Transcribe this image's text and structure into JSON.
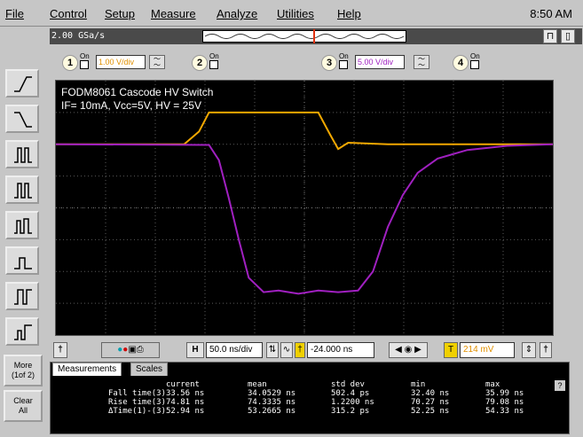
{
  "menu": {
    "items": [
      "File",
      "Control",
      "Setup",
      "Measure",
      "Analyze",
      "Utilities",
      "Help"
    ],
    "clock": "8:50 AM"
  },
  "top": {
    "sample_rate": "2.00 GSa/s"
  },
  "channels": [
    {
      "num": "1",
      "on": "On",
      "scale": "1.00 V/div",
      "color": "#f2a800"
    },
    {
      "num": "2",
      "on": "On",
      "scale": "",
      "color": "#00a000"
    },
    {
      "num": "3",
      "on": "On",
      "scale": "5.00 V/div",
      "color": "#a020c0"
    },
    {
      "num": "4",
      "on": "On",
      "scale": "",
      "color": "#e04040"
    }
  ],
  "plot": {
    "title_line1": "FODM8061 Cascode HV Switch",
    "title_line2": "IF= 10mA, Vcc=5V, HV = 25V"
  },
  "chart_data": {
    "type": "line",
    "title": "FODM8061 Cascode HV Switch",
    "subtitle": "IF= 10mA, Vcc=5V, HV = 25V",
    "xlabel": "",
    "ylabel": "",
    "x_range_ns": [
      -274,
      226
    ],
    "y_range_div": [
      -4,
      4
    ],
    "grid": true,
    "series": [
      {
        "name": "1",
        "color": "#f2a800",
        "points_x_ns": [
          -274,
          -145,
          -130,
          -120,
          -20,
          -10,
          2,
          10,
          20,
          60,
          226
        ],
        "points_y_div": [
          2.0,
          2.0,
          2.4,
          3.0,
          3.0,
          3.0,
          2.3,
          1.85,
          2.05,
          2.0,
          2.0
        ]
      },
      {
        "name": "3",
        "color": "#a020c0",
        "points_x_ns": [
          -274,
          -120,
          -110,
          -100,
          -90,
          -80,
          -65,
          -50,
          -30,
          -10,
          10,
          30,
          45,
          60,
          75,
          90,
          110,
          140,
          180,
          226
        ],
        "points_y_div": [
          2.0,
          1.98,
          1.5,
          0.3,
          -1.0,
          -2.2,
          -2.65,
          -2.6,
          -2.7,
          -2.6,
          -2.65,
          -2.6,
          -2.0,
          -0.6,
          0.4,
          1.1,
          1.55,
          1.82,
          1.95,
          2.0
        ]
      }
    ]
  },
  "horizontal": {
    "timebase": "50.0 ns/div",
    "delay": "-24.000 ns",
    "trigger_level": "214 mV"
  },
  "measurements": {
    "tabs": [
      "Measurements",
      "Scales"
    ],
    "headers": [
      "current",
      "mean",
      "std dev",
      "min",
      "max"
    ],
    "rows": [
      {
        "label": "Fall time(3)",
        "current": "33.56 ns",
        "mean": "34.0529 ns",
        "std_dev": "502.4 ps",
        "min": "32.40 ns",
        "max": "35.99 ns"
      },
      {
        "label": "Rise time(3)",
        "current": "74.81 ns",
        "mean": "74.3335 ns",
        "std_dev": "1.2200 ns",
        "min": "70.27 ns",
        "max": "79.08 ns"
      },
      {
        "label": "ΔTime(1)-(3)",
        "current": "52.94 ns",
        "mean": "53.2665 ns",
        "std_dev": "315.2 ps",
        "min": "52.25 ns",
        "max": "54.33 ns"
      }
    ]
  },
  "side": {
    "more_line1": "More",
    "more_line2": "(1of 2)",
    "clear_line1": "Clear",
    "clear_line2": "All"
  }
}
